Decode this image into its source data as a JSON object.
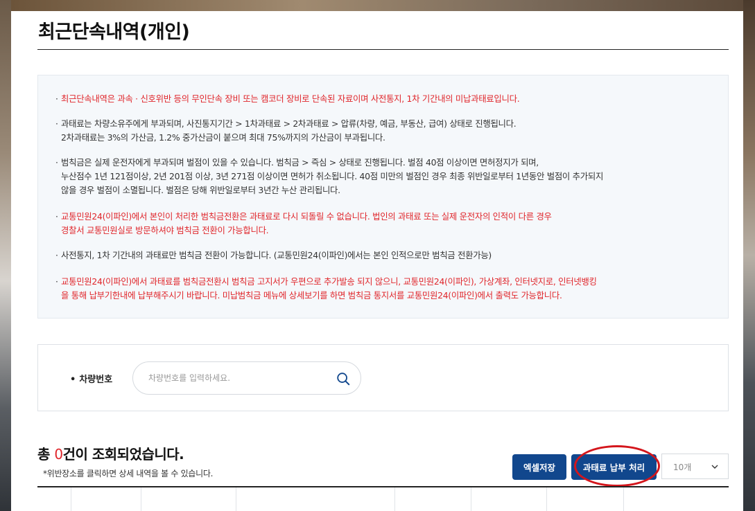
{
  "page_title": "최근단속내역(개인)",
  "notices": [
    {
      "color": "red",
      "lines": [
        "최근단속내역은 과속 · 신호위반 등의 무인단속 장비 또는 캠코더 장비로 단속된 자료이며 사전통지, 1차 기간내의 미납과태료입니다."
      ]
    },
    {
      "color": "black",
      "lines": [
        "과태료는 차량소유주에게 부과되며, 사진통지기간 > 1차과태료 > 2차과태료 > 압류(차량, 예금, 부동산, 급여) 상태로 진행됩니다.",
        "2차과태료는 3%의 가산금, 1.2% 중가산금이 붙으며 최대 75%까지의 가산금이 부과됩니다."
      ]
    },
    {
      "color": "black",
      "lines": [
        "범칙금은 실제 운전자에게 부과되며 벌점이 있을 수 있습니다. 범칙금 > 즉심 > 상태로 진행됩니다. 벌점 40점 이상이면 면허정지가 되며,",
        "누산점수 1년 121점이상, 2년 201점 이상, 3년 271점 이상이면 면허가 취소됩니다. 40점 미만의 벌점인 경우 최종 위반일로부터 1년동안 벌점이 추가되지",
        "않을 경우 벌점이 소멸됩니다. 벌점은 당해 위반일로부터 3년간 누산 관리됩니다."
      ]
    },
    {
      "color": "red",
      "lines": [
        "교통민원24(이파인)에서 본인이 처리한 범칙금전환은 과태료로 다시 되돌릴 수 없습니다. 법인의 과태료 또는 실제 운전자의 인적이 다른 경우",
        "경찰서 교통민원실로 방문하셔야 범칙금 전환이 가능합니다."
      ]
    },
    {
      "color": "black",
      "lines": [
        "사전통지, 1차 기간내의 과태료만 범칙금 전환이 가능합니다. (교통민원24(이파인)에서는 본인 인적으로만 범칙금 전환가능)"
      ]
    },
    {
      "color": "red",
      "lines": [
        "교통민원24(이파인)에서 과태료를 범칙금전환시 범칙금 고지서가 우편으로 추가발송 되지 않으니, 교통민원24(이파인), 가상계좌, 인터넷지로, 인터넷뱅킹",
        "을 통해 납부기한내에 납부해주시기 바랍니다. 미납범칙금 메뉴에 상세보기를 하면 범칙금 통지서를 교통민원24(이파인)에서 출력도 가능합니다."
      ]
    }
  ],
  "search": {
    "label": "차량번호",
    "placeholder": "차량번호를 입력하세요.",
    "icon": "search-icon"
  },
  "result": {
    "prefix": "총 ",
    "count": "0",
    "suffix": "건이 조회되었습니다.",
    "note": "*위반장소를 클릭하면 상세 내역을 볼 수 있습니다."
  },
  "buttons": {
    "excel": "엑셀저장",
    "pay": "과태료 납부 처리"
  },
  "page_size": {
    "selected": "10개",
    "icon": "chevron-down-icon"
  },
  "colors": {
    "accent_blue": "#11478d",
    "warning_red": "#e0262b",
    "highlight_red": "#d4161c"
  }
}
